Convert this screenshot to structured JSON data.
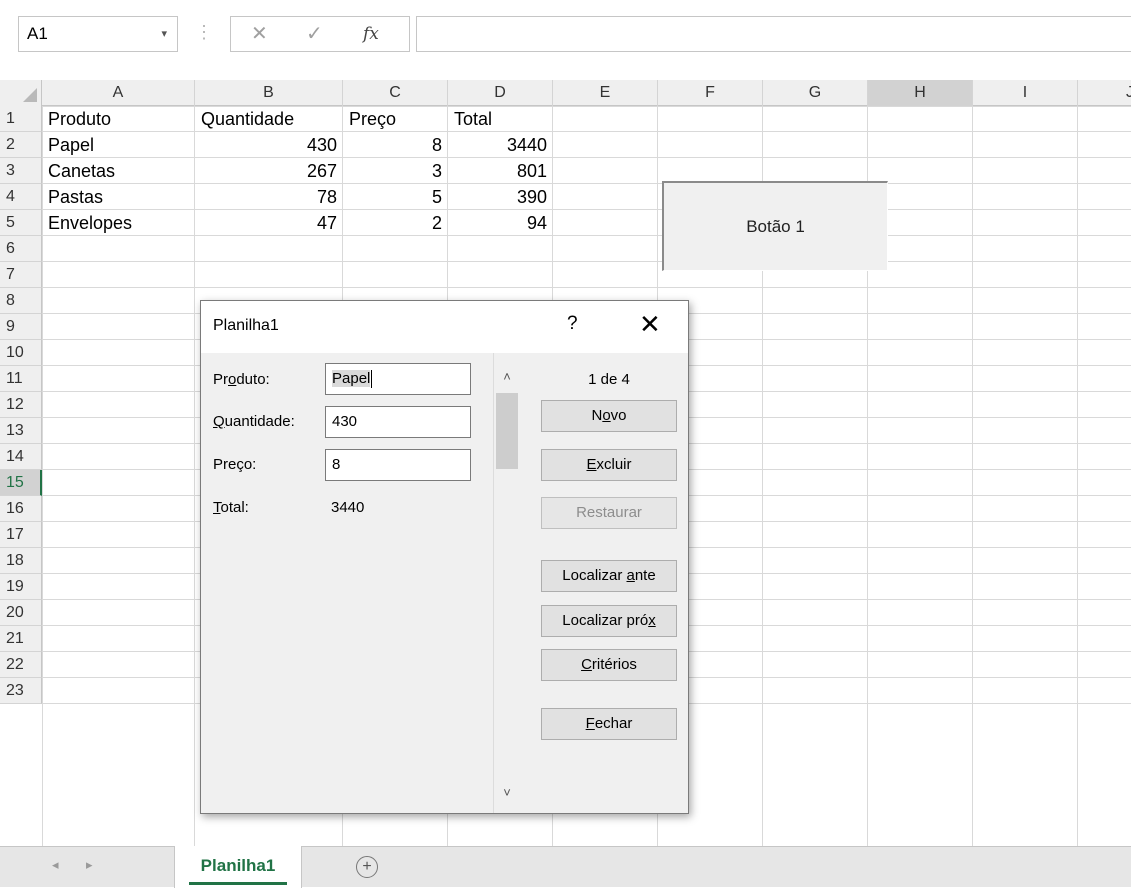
{
  "formula_bar": {
    "name_box": "A1",
    "name_box_caret": "▾",
    "separator": "⋮",
    "cancel_icon": "✕",
    "enter_icon": "✓",
    "fx_label": "fx",
    "formula_value": ""
  },
  "columns": [
    "A",
    "B",
    "C",
    "D",
    "E",
    "F",
    "G",
    "H",
    "I",
    "J"
  ],
  "selected_column": "H",
  "rows": [
    "1",
    "2",
    "3",
    "4",
    "5",
    "6",
    "7",
    "8",
    "9",
    "10",
    "11",
    "12",
    "13",
    "14",
    "15",
    "16",
    "17",
    "18",
    "19",
    "20",
    "21",
    "22",
    "23"
  ],
  "selected_row": "15",
  "table": {
    "headers": [
      "Produto",
      "Quantidade",
      "Preço",
      "Total"
    ],
    "rows": [
      [
        "Papel",
        "430",
        "8",
        "3440"
      ],
      [
        "Canetas",
        "267",
        "3",
        "801"
      ],
      [
        "Pastas",
        "78",
        "5",
        "390"
      ],
      [
        "Envelopes",
        "47",
        "2",
        "94"
      ]
    ]
  },
  "sheet_button": {
    "label": "Botão 1"
  },
  "dialog": {
    "title": "Planilha1",
    "help": "?",
    "close": "✕",
    "fields": {
      "produto": {
        "label_pre": "Pr",
        "label_ul": "o",
        "label_post": "duto:",
        "value": "Papel"
      },
      "quantidade": {
        "label_pre": "",
        "label_ul": "Q",
        "label_post": "uantidade:",
        "value": "430"
      },
      "preco": {
        "label_pre": "Preço:",
        "label_ul": "",
        "label_post": "",
        "value": "8"
      },
      "total": {
        "label_pre": "",
        "label_ul": "T",
        "label_post": "otal:",
        "value": "3440"
      }
    },
    "record_counter": "1 de 4",
    "scroll_up": "˄",
    "scroll_down": "˅",
    "buttons": {
      "novo": {
        "pre": "N",
        "ul": "o",
        "post": "vo"
      },
      "excluir": {
        "pre": "",
        "ul": "E",
        "post": "xcluir"
      },
      "restaurar": {
        "pre": "Restaurar",
        "ul": "",
        "post": ""
      },
      "localizar_ante": {
        "pre": "Localizar ",
        "ul": "a",
        "post": "nte"
      },
      "localizar_prox": {
        "pre": "Localizar pró",
        "ul": "x",
        "post": ""
      },
      "criterios": {
        "pre": "",
        "ul": "C",
        "post": "ritérios"
      },
      "fechar": {
        "pre": "",
        "ul": "F",
        "post": "echar"
      }
    }
  },
  "tabs": {
    "prev": "◂",
    "next": "▸",
    "sheet": "Planilha1",
    "add": "+"
  }
}
